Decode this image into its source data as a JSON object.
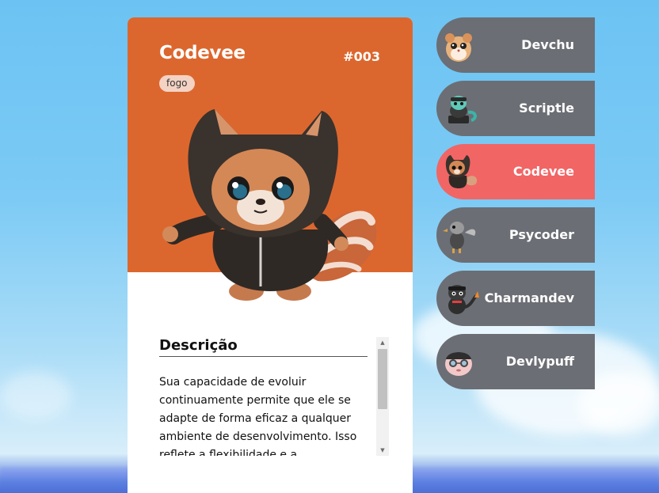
{
  "featured": {
    "name": "Codevee",
    "number": "#003",
    "type": "fogo",
    "description_title": "Descrição",
    "description": "Sua capacidade de evoluir continuamente permite que ele se adapte de forma eficaz a qualquer ambiente de desenvolvimento. Isso reflete a flexibilidade e a",
    "accent_color": "#dc672e"
  },
  "characters": [
    {
      "name": "Devchu",
      "icon": "hamster-avatar-icon",
      "active": false
    },
    {
      "name": "Scriptle",
      "icon": "turtle-avatar-icon",
      "active": false
    },
    {
      "name": "Codevee",
      "icon": "red-panda-avatar-icon",
      "active": true
    },
    {
      "name": "Psycoder",
      "icon": "duck-avatar-icon",
      "active": false
    },
    {
      "name": "Charmandev",
      "icon": "lizard-avatar-icon",
      "active": false
    },
    {
      "name": "Devlypuff",
      "icon": "puff-avatar-icon",
      "active": false
    }
  ],
  "colors": {
    "list_item": "#6b6e74",
    "list_item_active": "#f26565",
    "type_badge": "#f4d3c4"
  }
}
